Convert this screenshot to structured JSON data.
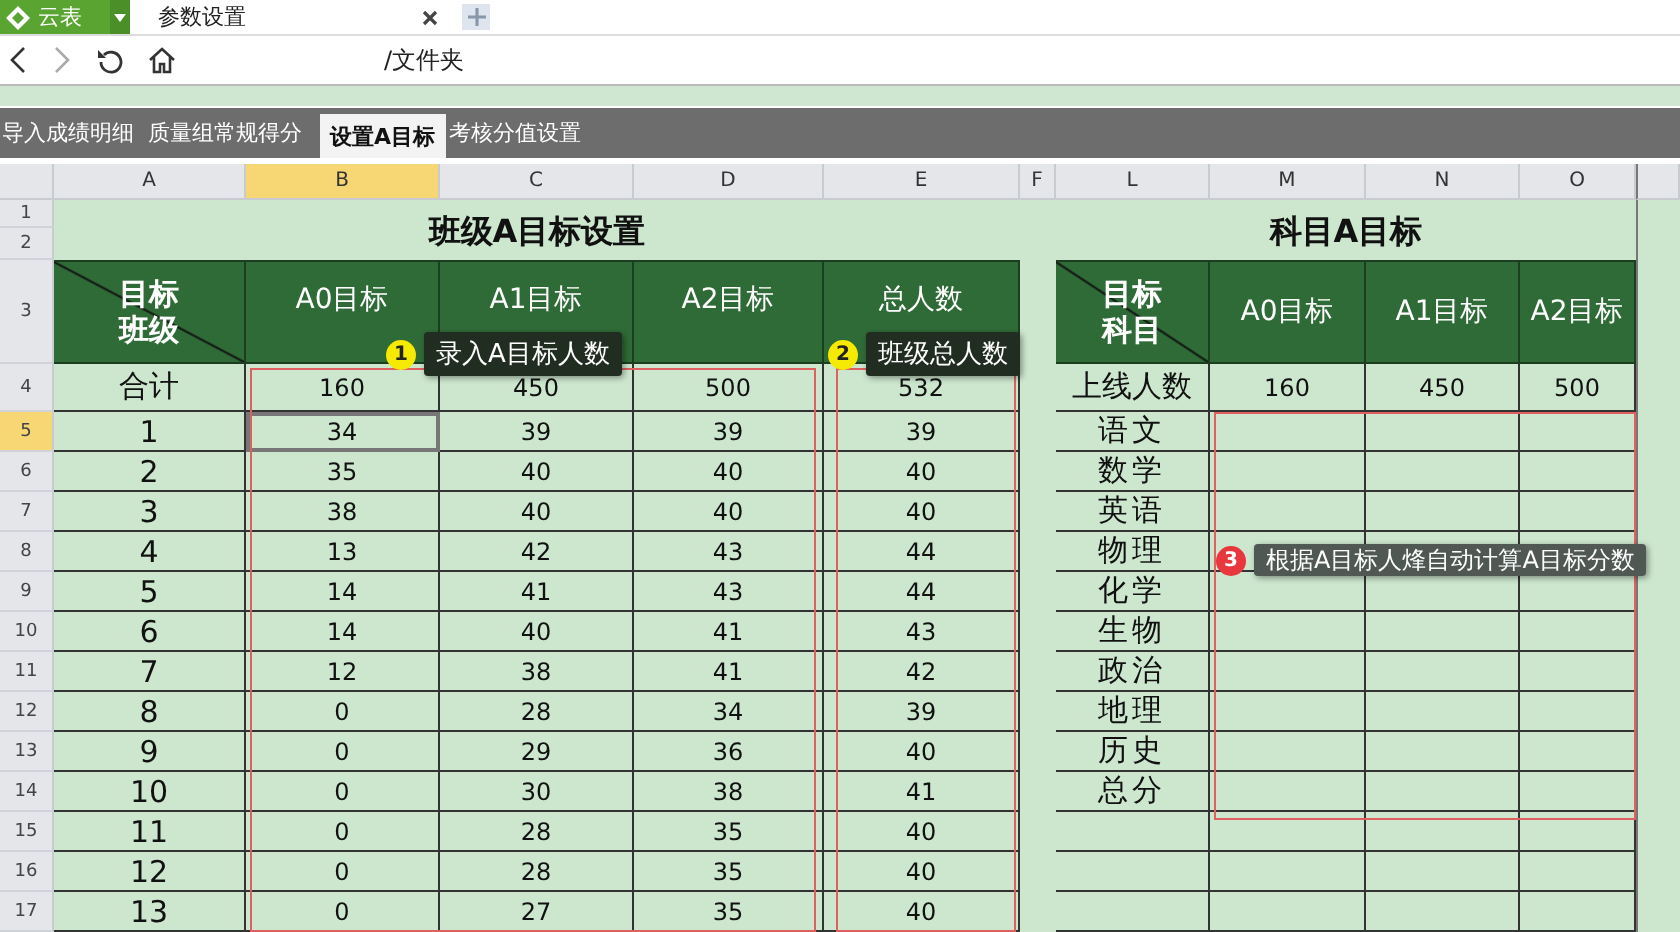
{
  "app_button": {
    "label": "云表"
  },
  "browser_tabs": [
    {
      "label": "参数设置",
      "selected": true
    }
  ],
  "address": "/文件夹",
  "sheet_tabs": [
    {
      "label": "导入成绩明细",
      "selected": false
    },
    {
      "label": "质量组常规得分",
      "selected": false
    },
    {
      "label": "设置A目标",
      "selected": true
    },
    {
      "label": "考核分值设置",
      "selected": false
    }
  ],
  "column_headers": [
    {
      "label": "A",
      "selected": false
    },
    {
      "label": "B",
      "selected": true
    },
    {
      "label": "C",
      "selected": false
    },
    {
      "label": "D",
      "selected": false
    },
    {
      "label": "E",
      "selected": false
    },
    {
      "label": "F",
      "selected": false
    },
    {
      "label": "L",
      "selected": false
    },
    {
      "label": "M",
      "selected": false
    },
    {
      "label": "N",
      "selected": false
    },
    {
      "label": "O",
      "selected": false
    }
  ],
  "row_numbers": [
    {
      "label": "1",
      "selected": false
    },
    {
      "label": "2",
      "selected": false
    },
    {
      "label": "3",
      "selected": false
    },
    {
      "label": "4",
      "selected": false
    },
    {
      "label": "5",
      "selected": true
    },
    {
      "label": "6",
      "selected": false
    },
    {
      "label": "7",
      "selected": false
    },
    {
      "label": "8",
      "selected": false
    },
    {
      "label": "9",
      "selected": false
    },
    {
      "label": "10",
      "selected": false
    },
    {
      "label": "11",
      "selected": false
    },
    {
      "label": "12",
      "selected": false
    },
    {
      "label": "13",
      "selected": false
    },
    {
      "label": "14",
      "selected": false
    },
    {
      "label": "15",
      "selected": false
    },
    {
      "label": "16",
      "selected": false
    },
    {
      "label": "17",
      "selected": false
    }
  ],
  "left_table": {
    "title": "班级A目标设置",
    "corner_top": "目标",
    "corner_bottom": "班级",
    "headers": [
      "A0目标",
      "A1目标",
      "A2目标",
      "总人数"
    ],
    "total_row": {
      "label": "合计",
      "values": [
        "160",
        "450",
        "500",
        "532"
      ]
    },
    "rows": [
      {
        "label": "1",
        "values": [
          "34",
          "39",
          "39",
          "39"
        ],
        "selected": true
      },
      {
        "label": "2",
        "values": [
          "35",
          "40",
          "40",
          "40"
        ],
        "selected": false
      },
      {
        "label": "3",
        "values": [
          "38",
          "40",
          "40",
          "40"
        ],
        "selected": false
      },
      {
        "label": "4",
        "values": [
          "13",
          "42",
          "43",
          "44"
        ],
        "selected": false
      },
      {
        "label": "5",
        "values": [
          "14",
          "41",
          "43",
          "44"
        ],
        "selected": false
      },
      {
        "label": "6",
        "values": [
          "14",
          "40",
          "41",
          "43"
        ],
        "selected": false
      },
      {
        "label": "7",
        "values": [
          "12",
          "38",
          "41",
          "42"
        ],
        "selected": false
      },
      {
        "label": "8",
        "values": [
          "0",
          "28",
          "34",
          "39"
        ],
        "selected": false
      },
      {
        "label": "9",
        "values": [
          "0",
          "29",
          "36",
          "40"
        ],
        "selected": false
      },
      {
        "label": "10",
        "values": [
          "0",
          "30",
          "38",
          "41"
        ],
        "selected": false
      },
      {
        "label": "11",
        "values": [
          "0",
          "28",
          "35",
          "40"
        ],
        "selected": false
      },
      {
        "label": "12",
        "values": [
          "0",
          "28",
          "35",
          "40"
        ],
        "selected": false
      },
      {
        "label": "13",
        "values": [
          "0",
          "27",
          "35",
          "40"
        ],
        "selected": false
      }
    ]
  },
  "right_table": {
    "title": "科目A目标",
    "corner_top": "目标",
    "corner_bottom": "科目",
    "headers": [
      "A0目标",
      "A1目标",
      "A2目标"
    ],
    "total_row": {
      "label": "上线人数",
      "values": [
        "160",
        "450",
        "500"
      ]
    },
    "subjects": [
      "语文",
      "数学",
      "英语",
      "物理",
      "化学",
      "生物",
      "政治",
      "地理",
      "历史",
      "总分"
    ]
  },
  "callouts": [
    {
      "number": "1",
      "text": "录入A目标人数",
      "color": "#f5ea00"
    },
    {
      "number": "2",
      "text": "班级总人数",
      "color": "#f5ea00"
    },
    {
      "number": "3",
      "text": "根据A目标人烽自动计算A目标分数",
      "color": "#e8383d"
    }
  ]
}
